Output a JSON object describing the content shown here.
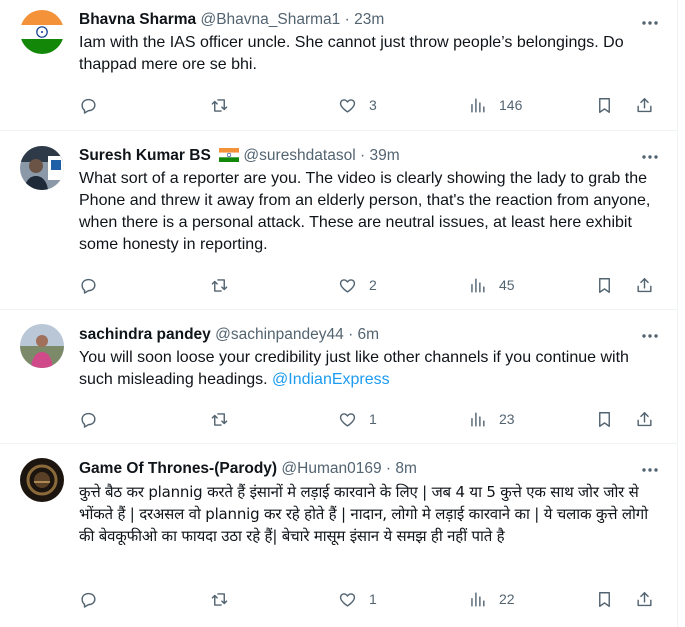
{
  "tweets": [
    {
      "name": "Bhavna Sharma",
      "handle": "@Bhavna_Sharma1",
      "dot": "·",
      "time": "23m",
      "has_flag": false,
      "text": "Iam with the IAS officer uncle. She cannot just throw people’s belongings. Do thappad mere ore se bhi.",
      "mention": "",
      "hindi": false,
      "replies": "",
      "retweets": "",
      "likes": "3",
      "views": "146",
      "avatar": "india-flag-avatar"
    },
    {
      "name": "Suresh Kumar BS",
      "handle": "@sureshdatasol",
      "dot": "·",
      "time": "39m",
      "has_flag": true,
      "text": "What sort of a reporter are you. The video is clearly showing the lady to grab the Phone and threw it away from an elderly person, that's the reaction from anyone, when there is a personal attack. These are neutral issues, at least here exhibit some honesty in reporting.",
      "mention": "",
      "hindi": false,
      "replies": "",
      "retweets": "",
      "likes": "2",
      "views": "45",
      "avatar": "photo-avatar"
    },
    {
      "name": "sachindra pandey",
      "handle": "@sachinpandey44",
      "dot": "·",
      "time": "6m",
      "has_flag": false,
      "text": "You will soon loose your credibility just like other channels if you continue with such misleading headings. ",
      "mention": "@IndianExpress",
      "hindi": false,
      "replies": "",
      "retweets": "",
      "likes": "1",
      "views": "23",
      "avatar": "photo-avatar"
    },
    {
      "name": "Game Of Thrones-(Parody)",
      "handle": "@Human0169",
      "dot": "·",
      "time": "8m",
      "has_flag": false,
      "text": "कुत्ते बैठ कर plannig करते हैं इंसानों मे लड़ाई कारवाने के लिए | जब 4 या 5 कुत्ते एक साथ जोर जोर से भोंकते हैं | दरअसल वो plannig कर रहे होते हैं | नादान, लोगो मे लड़ाई कारवाने का | ये चलाक कुत्ते लोगो की बेवकूफीओ का फायदा उठा रहे हैं| बेचारे मासूम इंसान ये समझ ही नहीं पाते है",
      "mention": "",
      "hindi": true,
      "replies": "",
      "retweets": "",
      "likes": "1",
      "views": "22",
      "avatar": "photo-avatar"
    }
  ],
  "icons": {
    "more": "more-options-icon",
    "reply": "reply-icon",
    "retweet": "retweet-icon",
    "like": "like-icon",
    "views": "views-icon",
    "bookmark": "bookmark-icon",
    "share": "share-icon"
  },
  "colors": {
    "text": "#0f1419",
    "secondary": "#536471",
    "link": "#1d9bf0",
    "divider": "#eff3f4"
  }
}
